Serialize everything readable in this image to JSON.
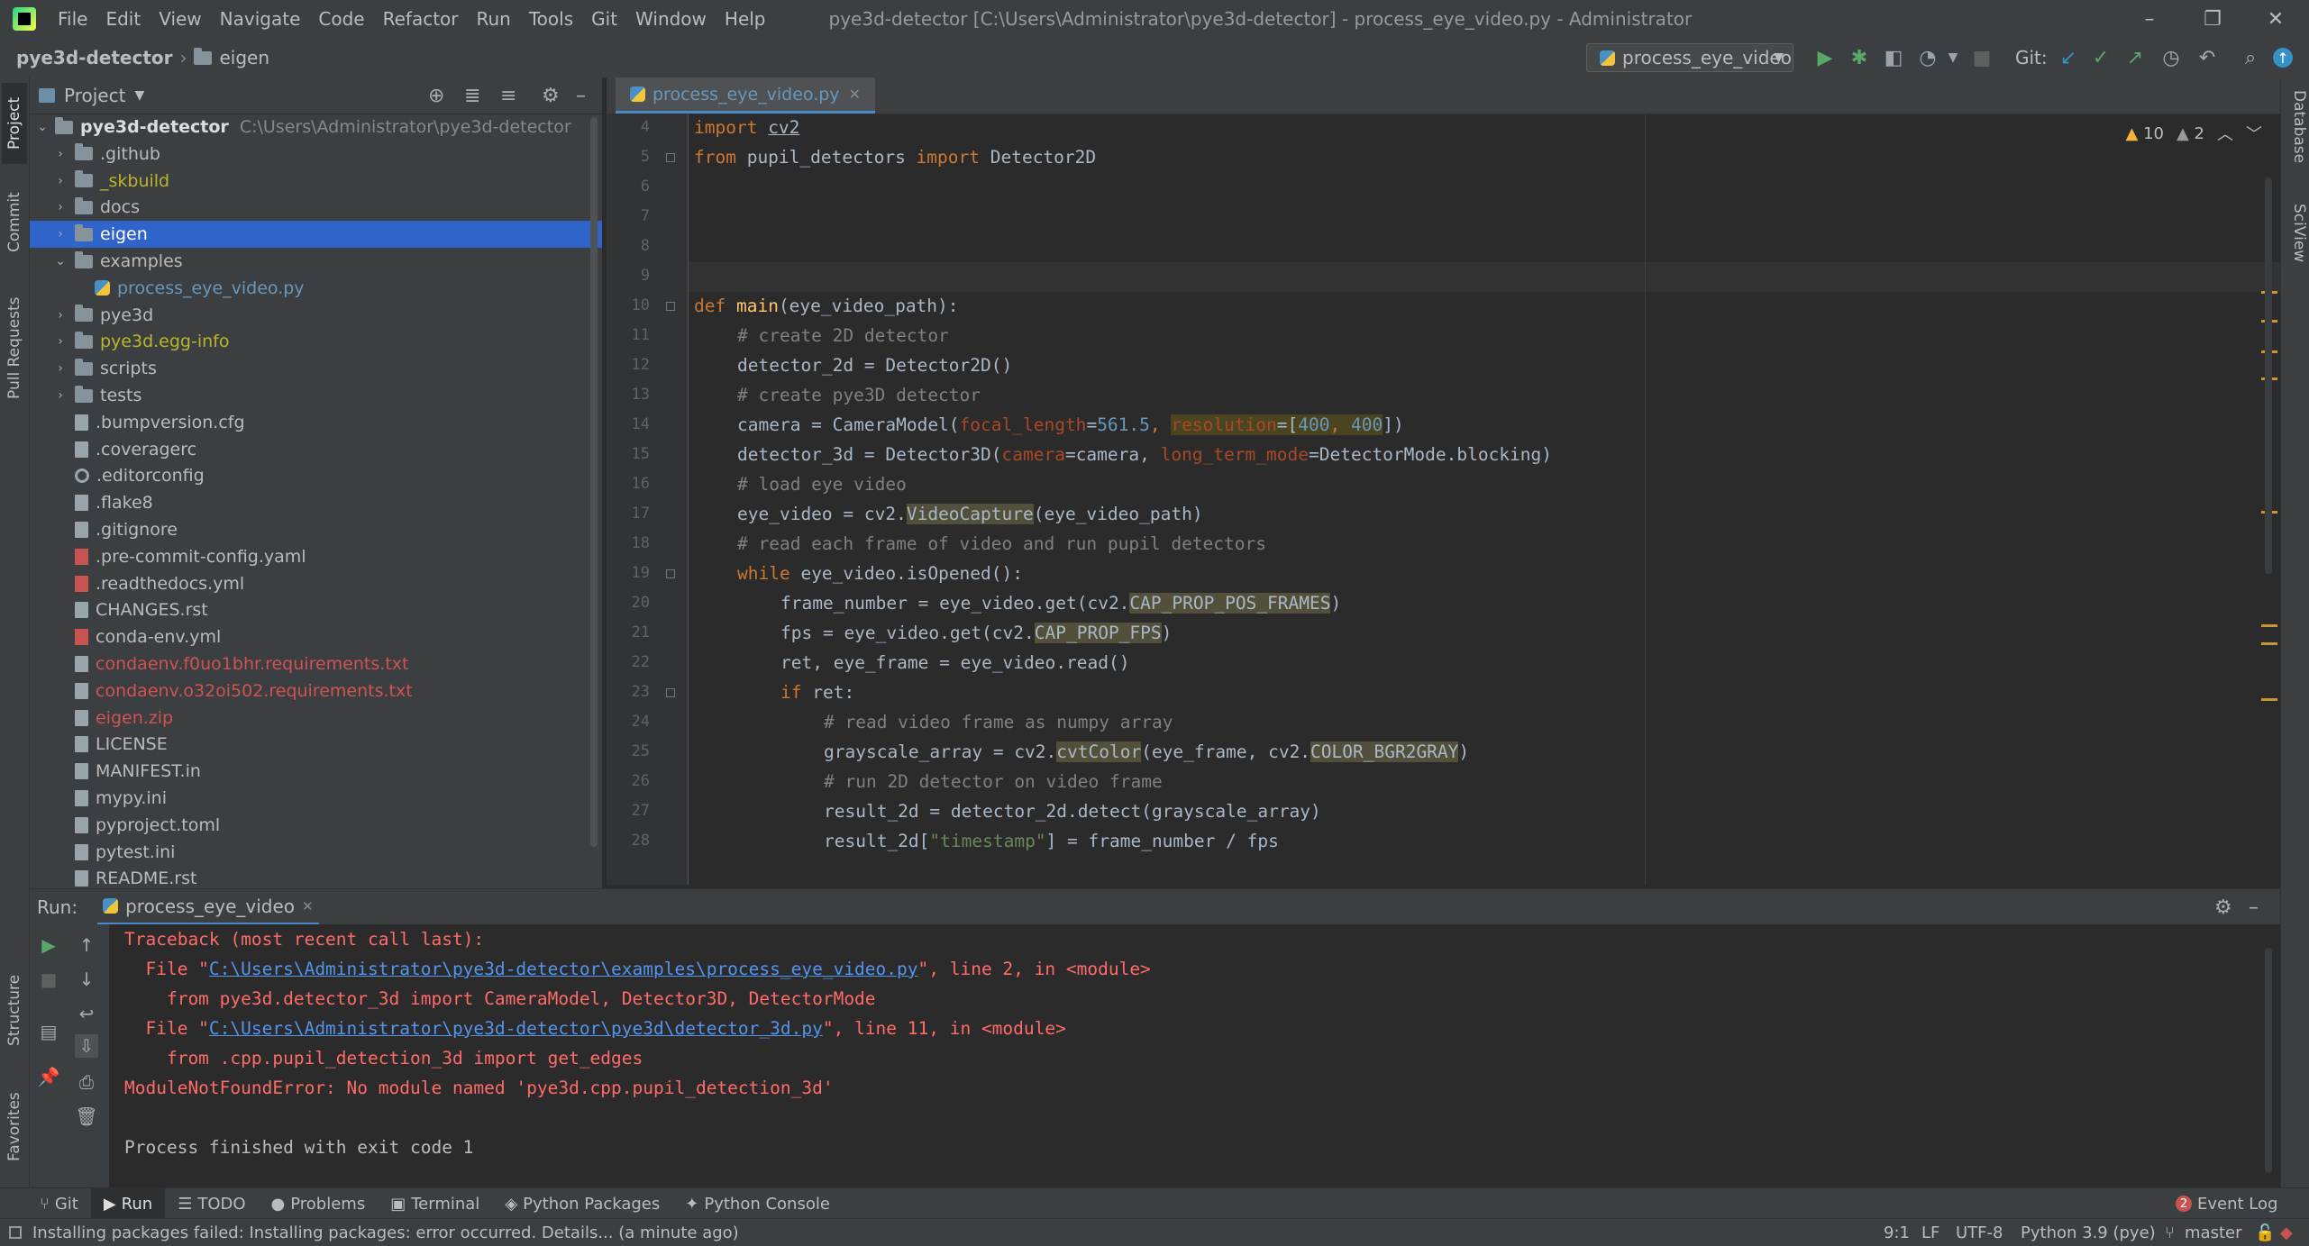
{
  "menu": [
    "File",
    "Edit",
    "View",
    "Navigate",
    "Code",
    "Refactor",
    "Run",
    "Tools",
    "Git",
    "Window",
    "Help"
  ],
  "window_title": "pye3d-detector [C:\\Users\\Administrator\\pye3d-detector] - process_eye_video.py - Administrator",
  "breadcrumb": {
    "project": "pye3d-detector",
    "folder": "eigen"
  },
  "run_config": "process_eye_video",
  "git_label": "Git:",
  "left_tabs": [
    "Project",
    "Commit",
    "Pull Requests",
    "Structure",
    "Favorites"
  ],
  "right_tabs": [
    "Database",
    "SciView"
  ],
  "project_panel": {
    "title": "Project",
    "root": {
      "name": "pye3d-detector",
      "path": "C:\\Users\\Administrator\\pye3d-detector"
    },
    "items": [
      {
        "label": ".github",
        "type": "folder",
        "color": "#bbbbbb"
      },
      {
        "label": "_skbuild",
        "type": "folder",
        "color": "#bbb529"
      },
      {
        "label": "docs",
        "type": "folder",
        "color": "#bbbbbb"
      },
      {
        "label": "eigen",
        "type": "folder",
        "color": "#ffffff"
      },
      {
        "label": "examples",
        "type": "folder-open",
        "color": "#bbbbbb"
      },
      {
        "label": "process_eye_video.py",
        "type": "py",
        "color": "#6897bb"
      },
      {
        "label": "pye3d",
        "type": "folder",
        "color": "#bbbbbb"
      },
      {
        "label": "pye3d.egg-info",
        "type": "folder",
        "color": "#bbb529"
      },
      {
        "label": "scripts",
        "type": "folder",
        "color": "#bbbbbb"
      },
      {
        "label": "tests",
        "type": "folder",
        "color": "#bbbbbb"
      },
      {
        "label": ".bumpversion.cfg",
        "type": "file",
        "color": "#bbbbbb"
      },
      {
        "label": ".coveragerc",
        "type": "file",
        "color": "#bbbbbb"
      },
      {
        "label": ".editorconfig",
        "type": "gear",
        "color": "#bbbbbb"
      },
      {
        "label": ".flake8",
        "type": "file",
        "color": "#bbbbbb"
      },
      {
        "label": ".gitignore",
        "type": "file",
        "color": "#bbbbbb"
      },
      {
        "label": ".pre-commit-config.yaml",
        "type": "yml",
        "color": "#bbbbbb"
      },
      {
        "label": ".readthedocs.yml",
        "type": "yml",
        "color": "#bbbbbb"
      },
      {
        "label": "CHANGES.rst",
        "type": "file",
        "color": "#bbbbbb"
      },
      {
        "label": "conda-env.yml",
        "type": "yml",
        "color": "#bbbbbb"
      },
      {
        "label": "condaenv.f0uo1bhr.requirements.txt",
        "type": "file",
        "color": "#d25252"
      },
      {
        "label": "condaenv.o32oi502.requirements.txt",
        "type": "file",
        "color": "#d25252"
      },
      {
        "label": "eigen.zip",
        "type": "file",
        "color": "#d25252"
      },
      {
        "label": "LICENSE",
        "type": "file",
        "color": "#bbbbbb"
      },
      {
        "label": "MANIFEST.in",
        "type": "file",
        "color": "#bbbbbb"
      },
      {
        "label": "mypy.ini",
        "type": "file",
        "color": "#bbbbbb"
      },
      {
        "label": "pyproject.toml",
        "type": "file",
        "color": "#bbbbbb"
      },
      {
        "label": "pytest.ini",
        "type": "file",
        "color": "#bbbbbb"
      },
      {
        "label": "README.rst",
        "type": "file",
        "color": "#bbbbbb"
      }
    ]
  },
  "editor": {
    "tab": "process_eye_video.py",
    "warnings": "10",
    "weak_warnings": "2",
    "line_numbers": [
      "4",
      "5",
      "6",
      "7",
      "8",
      "9",
      "10",
      "11",
      "12",
      "13",
      "14",
      "15",
      "16",
      "17",
      "18",
      "19",
      "20",
      "21",
      "22",
      "23",
      "24",
      "25",
      "26",
      "27",
      "28"
    ],
    "code": {
      "l4a": "import ",
      "l4b": "cv2",
      "l5a": "from ",
      "l5b": "pupil_detectors ",
      "l5c": "import ",
      "l5d": "Detector2D",
      "l10a": "def ",
      "l10b": "main",
      "l10c": "(eye_video_path):",
      "l11": "# create 2D detector",
      "l12": "detector_2d = Detector2D()",
      "l13": "# create pye3D detector",
      "l14a": "camera = CameraModel(",
      "l14b": "focal_length",
      "l14c": "=",
      "l14d": "561.5",
      "l14e": ", ",
      "l14f": "resolution",
      "l14g": "=[",
      "l14h": "400",
      "l14i": ", ",
      "l14j": "400",
      "l14k": "])",
      "l15a": "detector_3d = Detector3D(",
      "l15b": "camera",
      "l15c": "=camera, ",
      "l15d": "long_term_mode",
      "l15e": "=DetectorMode.blocking)",
      "l16": "# load eye video",
      "l17a": "eye_video = cv2.",
      "l17b": "VideoCapture",
      "l17c": "(eye_video_path)",
      "l18": "# read each frame of video and run pupil detectors",
      "l19a": "while ",
      "l19b": "eye_video.isOpened():",
      "l20a": "frame_number = eye_video.get(cv2.",
      "l20b": "CAP_PROP_POS_FRAMES",
      "l20c": ")",
      "l21a": "fps = eye_video.get(cv2.",
      "l21b": "CAP_PROP_FPS",
      "l21c": ")",
      "l22a": "ret",
      "l22b": ", eye_frame = eye_video.read()",
      "l23a": "if ",
      "l23b": "ret:",
      "l24": "# read video frame as numpy array",
      "l25a": "grayscale_array = cv2.",
      "l25b": "cvtColor",
      "l25c": "(eye_frame, cv2.",
      "l25d": "COLOR_BGR2GRAY",
      "l25e": ")",
      "l26": "# run 2D detector on video frame",
      "l27": "result_2d = detector_2d.detect(grayscale_array)",
      "l28a": "result_2d[",
      "l28b": "\"timestamp\"",
      "l28c": "] = frame_number / fps"
    }
  },
  "run_panel": {
    "label": "Run:",
    "tab": "process_eye_video",
    "console": {
      "c1": "Traceback (most recent call last):",
      "c2a": "  File \"",
      "c2b": "C:\\Users\\Administrator\\pye3d-detector\\examples\\process_eye_video.py",
      "c2c": "\", line 2, in <module>",
      "c3": "    from pye3d.detector_3d import CameraModel, Detector3D, DetectorMode",
      "c4a": "  File \"",
      "c4b": "C:\\Users\\Administrator\\pye3d-detector\\pye3d\\detector_3d.py",
      "c4c": "\", line 11, in <module>",
      "c5": "    from .cpp.pupil_detection_3d import get_edges",
      "c6": "ModuleNotFoundError: No module named 'pye3d.cpp.pupil_detection_3d'",
      "c7": "Process finished with exit code 1"
    }
  },
  "tool_tabs": [
    "Git",
    "Run",
    "TODO",
    "Problems",
    "Terminal",
    "Python Packages",
    "Python Console"
  ],
  "event_log": {
    "count": "2",
    "label": "Event Log"
  },
  "status": {
    "message": "Installing packages failed: Installing packages: error occurred. Details... (a minute ago)",
    "position": "9:1",
    "line_sep": "LF",
    "encoding": "UTF-8",
    "interpreter": "Python 3.9 (pye)",
    "branch": "master"
  }
}
